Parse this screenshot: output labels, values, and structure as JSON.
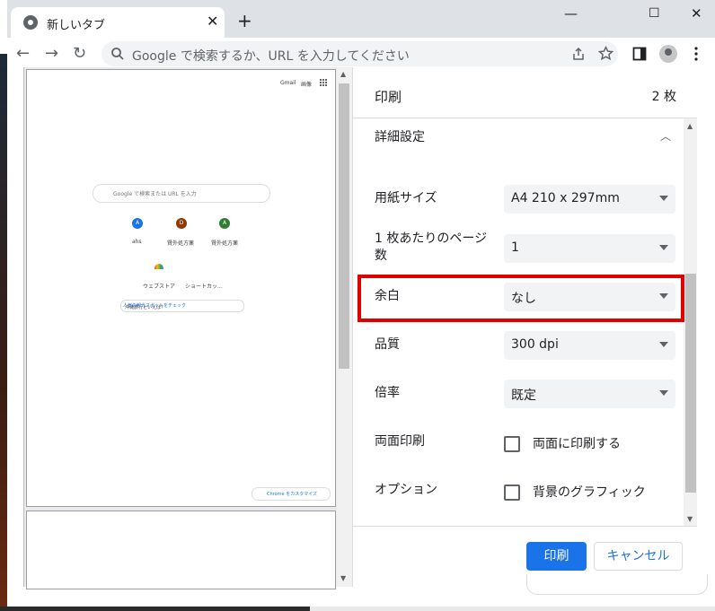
{
  "browser": {
    "tab_title": "新しいタブ",
    "tab_close": "✕",
    "new_tab": "+",
    "omnibox_placeholder": "Google で検索するか、URL を入力してください",
    "window_controls": {
      "minimize": "—",
      "maximize": "☐",
      "close": "✕"
    },
    "nav": {
      "back": "←",
      "forward": "→",
      "reload": "↻"
    }
  },
  "preview": {
    "gmail": "Gmail",
    "images": "画像",
    "search_placeholder": "Google で検索または URL を入力",
    "shortcuts": [
      {
        "letter": "A",
        "label": "ahs",
        "color": "#1a73e8"
      },
      {
        "letter": "D",
        "label": "賢外処方薬",
        "color": "#8b3a00"
      },
      {
        "letter": "A",
        "label": "賢外処方薬",
        "color": "#2e7d32"
      }
    ],
    "shortcuts2": [
      "ウェブストア",
      "ショートカッ..."
    ],
    "prompt_text": "沖縄旅行といえば？",
    "prompt_link": "人気の観光スポットをチェック",
    "customize": "Chrome をカスタマイズ"
  },
  "settings": {
    "title": "印刷",
    "page_count": "2 枚",
    "detail_label": "詳細設定",
    "rows": [
      {
        "label": "用紙サイズ",
        "value": "A4 210 x 297mm"
      },
      {
        "label": "1 枚あたりのページ",
        "label2": "数",
        "value": "1"
      },
      {
        "label": "余白",
        "value": "なし"
      },
      {
        "label": "品質",
        "value": "300 dpi"
      },
      {
        "label": "倍率",
        "value": "既定"
      }
    ],
    "duplex": {
      "label": "両面印刷",
      "option": "両面に印刷する",
      "checked": false
    },
    "options": {
      "label": "オプション",
      "option": "背景のグラフィック",
      "checked": false
    },
    "print_button": "印刷",
    "cancel_button": "キャンセル"
  },
  "colors": {
    "accent": "#1a73e8",
    "highlight": "#e00000"
  }
}
